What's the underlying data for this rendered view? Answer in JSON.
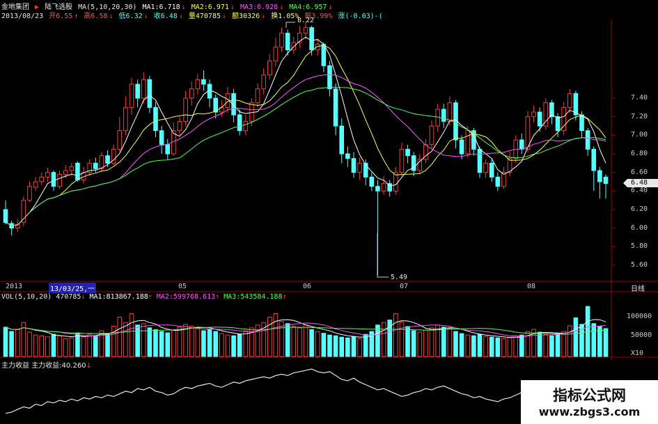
{
  "header": {
    "stock_name": "金地集团",
    "stock_marker": "▶",
    "indicator_name": "陆飞选股",
    "ma_params": "MA(5,10,20,30)",
    "ma1": "MA1:6.718",
    "ma2": "MA2:6.971",
    "ma3": "MA3:6.926",
    "ma4": "MA4:6.957",
    "date": "2013/08/23",
    "open": "开6.55",
    "high": "高6.58",
    "low": "低6.32",
    "close": "收6.48",
    "volume": "量470785",
    "amount": "额30326",
    "turnover": "换1.05%",
    "amplitude": "振3.99%",
    "change": "涨(-0.03)-("
  },
  "price_axis": {
    "labels": [
      "7.40",
      "7.20",
      "7.00",
      "6.80",
      "6.60",
      "6.40",
      "6.20",
      "6.00",
      "5.80",
      "5.60"
    ],
    "current_price": "6.48"
  },
  "annotations": {
    "high_label": "8.22",
    "low_label": "5.49"
  },
  "time_axis": {
    "labels": [
      {
        "text": "2013",
        "highlight": false
      },
      {
        "text": "13/03/25,一",
        "highlight": true
      },
      {
        "text": "05",
        "highlight": false
      },
      {
        "text": "06",
        "highlight": false
      },
      {
        "text": "07",
        "highlight": false
      },
      {
        "text": "08",
        "highlight": false
      }
    ],
    "period": "日线"
  },
  "volume_panel": {
    "title": "VOL(5,10,20)",
    "value": "470785",
    "ma1": "MA1:813867.188",
    "ma2": "MA2:599768.613",
    "ma3": "MA3:543584.188",
    "axis_labels": [
      "100000",
      "50000"
    ],
    "unit": "X10"
  },
  "indicator_panel": {
    "title": "主力收益",
    "value_label": "主力收益:40.260"
  },
  "watermark": {
    "title": "指标公式网",
    "url": "www.zbgs3.com"
  },
  "colors": {
    "up": "#ff3b3b",
    "down": "#54ffff",
    "ma1": "#ffffff",
    "ma2": "#ffff55",
    "ma3": "#ff55ff",
    "ma4": "#55ff55",
    "axis": "#a00000"
  },
  "candles": [
    [
      6.2,
      6.06,
      6.3,
      6.04
    ],
    [
      6.05,
      6.0,
      6.08,
      5.92
    ],
    [
      6.0,
      6.04,
      6.1,
      5.96
    ],
    [
      6.06,
      6.3,
      6.34,
      6.02
    ],
    [
      6.3,
      6.45,
      6.5,
      6.28
    ],
    [
      6.44,
      6.5,
      6.55,
      6.4
    ],
    [
      6.5,
      6.55,
      6.6,
      6.46
    ],
    [
      6.55,
      6.6,
      6.65,
      6.5
    ],
    [
      6.6,
      6.45,
      6.62,
      6.4
    ],
    [
      6.45,
      6.58,
      6.62,
      6.42
    ],
    [
      6.58,
      6.62,
      6.68,
      6.54
    ],
    [
      6.62,
      6.66,
      6.7,
      6.56
    ],
    [
      6.7,
      6.52,
      6.72,
      6.5
    ],
    [
      6.52,
      6.6,
      6.66,
      6.48
    ],
    [
      6.6,
      6.7,
      6.74,
      6.56
    ],
    [
      6.7,
      6.64,
      6.76,
      6.6
    ],
    [
      6.64,
      6.78,
      6.82,
      6.6
    ],
    [
      6.78,
      6.7,
      6.84,
      6.66
    ],
    [
      6.7,
      6.85,
      6.9,
      6.68
    ],
    [
      6.85,
      7.05,
      7.2,
      6.82
    ],
    [
      7.05,
      7.3,
      7.42,
      7.0
    ],
    [
      7.3,
      7.55,
      7.62,
      7.22
    ],
    [
      7.55,
      7.4,
      7.6,
      7.3
    ],
    [
      7.4,
      7.6,
      7.68,
      7.34
    ],
    [
      7.6,
      7.3,
      7.64,
      7.24
    ],
    [
      7.3,
      7.05,
      7.36,
      6.98
    ],
    [
      7.05,
      6.9,
      7.1,
      6.8
    ],
    [
      6.9,
      6.8,
      6.96,
      6.74
    ],
    [
      6.8,
      7.05,
      7.14,
      6.78
    ],
    [
      7.05,
      7.15,
      7.2,
      7.0
    ],
    [
      7.15,
      7.4,
      7.48,
      7.1
    ],
    [
      7.4,
      7.5,
      7.58,
      7.32
    ],
    [
      7.5,
      7.6,
      7.66,
      7.44
    ],
    [
      7.6,
      7.55,
      7.7,
      7.48
    ],
    [
      7.55,
      7.4,
      7.6,
      7.3
    ],
    [
      7.4,
      7.25,
      7.44,
      7.18
    ],
    [
      7.25,
      7.3,
      7.38,
      7.2
    ],
    [
      7.3,
      7.45,
      7.52,
      7.24
    ],
    [
      7.45,
      7.22,
      7.5,
      7.14
    ],
    [
      7.22,
      7.05,
      7.28,
      7.0
    ],
    [
      7.05,
      7.15,
      7.22,
      7.0
    ],
    [
      7.15,
      7.35,
      7.4,
      7.1
    ],
    [
      7.35,
      7.5,
      7.56,
      7.3
    ],
    [
      7.5,
      7.65,
      7.72,
      7.44
    ],
    [
      7.65,
      7.8,
      7.88,
      7.6
    ],
    [
      7.8,
      7.95,
      8.05,
      7.74
    ],
    [
      7.95,
      8.1,
      8.16,
      7.9
    ],
    [
      8.1,
      7.92,
      8.14,
      7.86
    ],
    [
      7.92,
      8.0,
      8.06,
      7.88
    ],
    [
      8.0,
      8.1,
      8.18,
      7.94
    ],
    [
      8.1,
      8.16,
      8.22,
      8.04
    ],
    [
      8.16,
      7.92,
      8.18,
      7.86
    ],
    [
      7.92,
      7.98,
      8.04,
      7.86
    ],
    [
      7.98,
      7.75,
      8.0,
      7.68
    ],
    [
      7.75,
      7.5,
      7.8,
      7.42
    ],
    [
      7.5,
      7.1,
      7.56,
      7.0
    ],
    [
      7.1,
      6.8,
      7.18,
      6.7
    ],
    [
      6.8,
      6.75,
      6.88,
      6.66
    ],
    [
      6.75,
      6.6,
      6.82,
      6.54
    ],
    [
      6.6,
      6.7,
      6.76,
      6.52
    ],
    [
      6.7,
      6.55,
      6.74,
      6.46
    ],
    [
      6.55,
      6.45,
      6.6,
      6.4
    ],
    [
      6.45,
      6.4,
      6.52,
      5.49
    ],
    [
      6.4,
      6.48,
      6.56,
      6.36
    ],
    [
      6.48,
      6.4,
      6.52,
      6.34
    ],
    [
      6.4,
      6.6,
      6.66,
      6.36
    ],
    [
      6.6,
      6.85,
      6.92,
      6.56
    ],
    [
      6.85,
      6.78,
      6.9,
      6.7
    ],
    [
      6.78,
      6.62,
      6.82,
      6.56
    ],
    [
      6.62,
      6.74,
      6.8,
      6.58
    ],
    [
      6.74,
      6.9,
      6.96,
      6.7
    ],
    [
      6.9,
      7.1,
      7.16,
      6.86
    ],
    [
      7.1,
      7.28,
      7.34,
      7.04
    ],
    [
      7.28,
      7.15,
      7.34,
      7.08
    ],
    [
      7.15,
      7.35,
      7.42,
      7.1
    ],
    [
      7.35,
      6.95,
      7.38,
      6.86
    ],
    [
      6.95,
      6.8,
      7.0,
      6.74
    ],
    [
      6.8,
      7.05,
      7.1,
      6.76
    ],
    [
      7.05,
      6.85,
      7.08,
      6.78
    ],
    [
      6.85,
      6.6,
      6.88,
      6.54
    ],
    [
      6.6,
      6.7,
      6.74,
      6.54
    ],
    [
      6.7,
      6.55,
      6.74,
      6.5
    ],
    [
      6.55,
      6.45,
      6.6,
      6.4
    ],
    [
      6.45,
      6.6,
      6.66,
      6.42
    ],
    [
      6.6,
      6.75,
      6.82,
      6.56
    ],
    [
      6.75,
      6.95,
      7.0,
      6.7
    ],
    [
      6.95,
      6.85,
      7.02,
      6.8
    ],
    [
      6.85,
      7.2,
      7.26,
      6.82
    ],
    [
      7.2,
      7.25,
      7.32,
      7.14
    ],
    [
      7.25,
      7.1,
      7.3,
      7.04
    ],
    [
      7.1,
      7.35,
      7.4,
      7.06
    ],
    [
      7.35,
      7.2,
      7.38,
      7.12
    ],
    [
      7.2,
      7.05,
      7.24,
      6.98
    ],
    [
      7.05,
      7.3,
      7.36,
      7.0
    ],
    [
      7.3,
      7.45,
      7.5,
      7.24
    ],
    [
      7.45,
      7.22,
      7.48,
      7.16
    ],
    [
      7.22,
      7.05,
      7.26,
      6.98
    ],
    [
      7.05,
      6.85,
      7.08,
      6.78
    ],
    [
      6.85,
      6.62,
      6.88,
      6.4
    ],
    [
      6.62,
      6.5,
      6.66,
      6.32
    ],
    [
      6.55,
      6.48,
      6.58,
      6.32
    ]
  ],
  "volumes": [
    82,
    70,
    75,
    95,
    68,
    60,
    58,
    55,
    62,
    58,
    50,
    52,
    66,
    55,
    62,
    58,
    72,
    64,
    85,
    110,
    95,
    120,
    88,
    92,
    80,
    75,
    70,
    66,
    74,
    82,
    90,
    85,
    78,
    72,
    76,
    70,
    64,
    60,
    58,
    62,
    72,
    80,
    88,
    95,
    110,
    120,
    98,
    92,
    84,
    80,
    88,
    75,
    70,
    65,
    60,
    58,
    54,
    52,
    56,
    50,
    62,
    70,
    88,
    95,
    102,
    120,
    96,
    84,
    72,
    68,
    74,
    80,
    88,
    82,
    78,
    70,
    64,
    60,
    58,
    62,
    56,
    54,
    52,
    50,
    54,
    58,
    60,
    70,
    76,
    68,
    62,
    58,
    64,
    70,
    86,
    108,
    90,
    140,
    92,
    84,
    78
  ],
  "indicator_values": [
    12,
    14,
    18,
    22,
    20,
    26,
    24,
    30,
    28,
    32,
    30,
    34,
    31,
    36,
    34,
    38,
    36,
    40,
    38,
    42,
    46,
    44,
    50,
    48,
    52,
    46,
    44,
    40,
    42,
    48,
    52,
    50,
    54,
    56,
    58,
    54,
    52,
    56,
    60,
    58,
    62,
    64,
    66,
    68,
    66,
    70,
    72,
    70,
    74,
    76,
    78,
    80,
    76,
    74,
    76,
    70,
    64,
    62,
    66,
    60,
    56,
    52,
    48,
    50,
    46,
    42,
    38,
    40,
    44,
    46,
    50,
    48,
    52,
    54,
    50,
    46,
    42,
    40,
    36,
    38,
    34,
    32,
    30,
    34,
    36,
    40,
    44,
    42,
    46,
    44,
    40,
    38,
    36,
    34,
    36,
    38,
    40,
    38,
    40,
    42,
    40
  ]
}
